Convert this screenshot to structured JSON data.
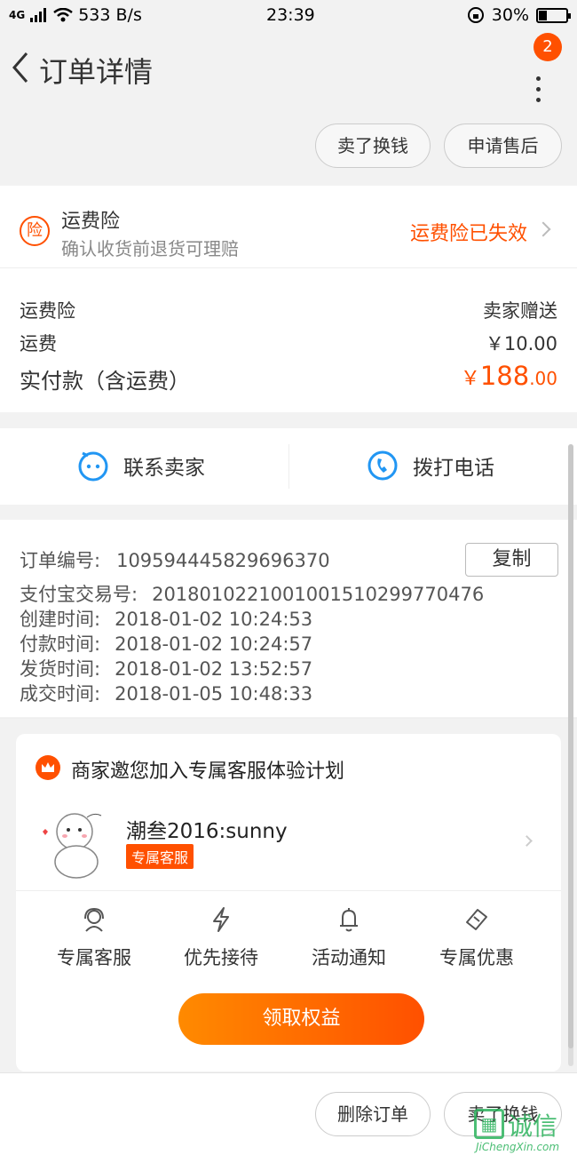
{
  "status_bar": {
    "network": "4G",
    "speed": "533 B/s",
    "time": "23:39",
    "battery": "30%"
  },
  "header": {
    "title": "订单详情",
    "notification_count": "2"
  },
  "actions": {
    "sell": "卖了换钱",
    "after_sale": "申请售后"
  },
  "insurance": {
    "icon_text": "险",
    "title": "运费险",
    "subtitle": "确认收货前退货可理赔",
    "status": "运费险已失效"
  },
  "fees": {
    "insurance_label": "运费险",
    "insurance_value": "卖家赠送",
    "shipping_label": "运费",
    "shipping_value": "￥10.00",
    "total_label": "实付款（含运费）",
    "total_symbol": "￥",
    "total_int": "188",
    "total_dec": ".00"
  },
  "contact": {
    "seller": "联系卖家",
    "call": "拨打电话"
  },
  "order": {
    "number_label": "订单编号:",
    "number": "109594445829696370",
    "copy": "复制",
    "alipay_label": "支付宝交易号:",
    "alipay": "2018010221001001510299770476",
    "created_label": "创建时间:",
    "created": "2018-01-02 10:24:53",
    "paid_label": "付款时间:",
    "paid": "2018-01-02 10:24:57",
    "shipped_label": "发货时间:",
    "shipped": "2018-01-02 13:52:57",
    "done_label": "成交时间:",
    "done": "2018-01-05 10:48:33"
  },
  "service": {
    "title": "商家邀您加入专属客服体验计划",
    "agent_name": "潮叁2016:sunny",
    "agent_tag": "专属客服",
    "benefits": [
      "专属客服",
      "优先接待",
      "活动通知",
      "专属优惠"
    ],
    "cta": "领取权益"
  },
  "bottom": {
    "delete": "删除订单",
    "sell": "卖了换钱"
  },
  "watermark": {
    "text": "诚信",
    "domain": "JiChengXin.com"
  },
  "colors": {
    "accent": "#ff5000",
    "blue": "#2196f3"
  }
}
